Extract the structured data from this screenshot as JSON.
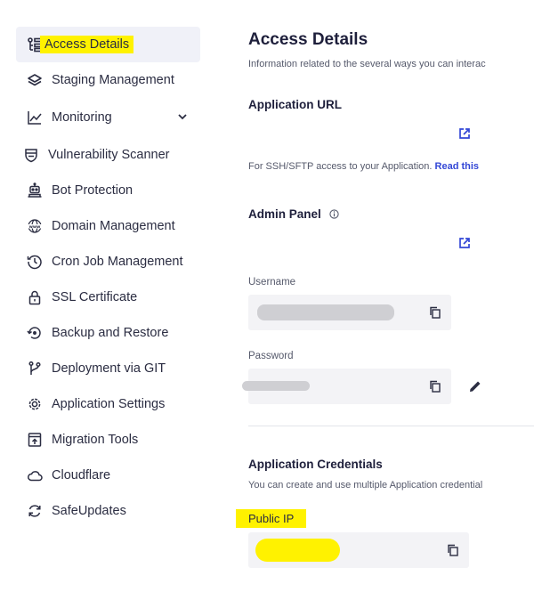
{
  "sidebar": {
    "items": [
      {
        "label": "Access Details",
        "icon": "access-details-icon",
        "active": true
      },
      {
        "label": "Staging Management",
        "icon": "layers-icon"
      },
      {
        "label": "Monitoring",
        "icon": "chart-line-icon",
        "has_dropdown": true
      },
      {
        "label": "Vulnerability Scanner",
        "icon": "shield-scan-icon"
      },
      {
        "label": "Bot Protection",
        "icon": "robot-icon"
      },
      {
        "label": "Domain Management",
        "icon": "www-globe-icon"
      },
      {
        "label": "Cron Job Management",
        "icon": "history-clock-icon"
      },
      {
        "label": "SSL Certificate",
        "icon": "lock-icon"
      },
      {
        "label": "Backup and Restore",
        "icon": "restore-icon"
      },
      {
        "label": "Deployment via GIT",
        "icon": "git-branch-icon"
      },
      {
        "label": "Application Settings",
        "icon": "gear-icon"
      },
      {
        "label": "Migration Tools",
        "icon": "migration-icon"
      },
      {
        "label": "Cloudflare",
        "icon": "cloud-icon"
      },
      {
        "label": "SafeUpdates",
        "icon": "refresh-icon"
      }
    ]
  },
  "main": {
    "title": "Access Details",
    "subtitle": "Information related to the several ways you can interac",
    "application_url": {
      "heading": "Application URL",
      "external_icon": "external-link-icon"
    },
    "ssh_note": {
      "text": "For SSH/SFTP access to your Application.",
      "link": "Read this"
    },
    "admin_panel": {
      "heading": "Admin Panel",
      "info_icon": "info-icon",
      "external_icon": "external-link-icon",
      "username_label": "Username",
      "password_label": "Password"
    },
    "credentials": {
      "heading": "Application Credentials",
      "subtitle": "You can create and use multiple Application credential",
      "public_ip_label": "Public IP"
    }
  },
  "colors": {
    "highlight": "#fff200",
    "link": "#3347d6",
    "field_bg": "#f3f3f6"
  }
}
